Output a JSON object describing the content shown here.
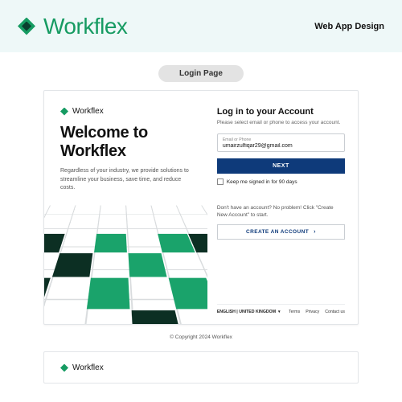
{
  "brand": {
    "name": "Workflex",
    "header_right": "Web App Design"
  },
  "section_label": "Login Page",
  "welcome": {
    "brand_small": "Workflex",
    "title_line1": "Welcome to",
    "title_line2": "Workflex",
    "subtitle": "Regardless of your industry, we provide solutions to streamline your business, save time, and reduce costs."
  },
  "login": {
    "heading": "Log in to your Account",
    "hint": "Please select email or phone to access your account.",
    "field_label": "Email or Phone",
    "field_value": "umairzulfiqar29@gmail.com",
    "next_label": "NEXT",
    "keep_label": "Keep me signed in for 90 days",
    "no_account_text": "Don't have an account? No problem! Click \"Create New Account\" to start.",
    "create_label": "CREATE AN ACCOUNT"
  },
  "footer": {
    "language": "ENGLISH | UNITED KINGDOM",
    "terms": "Terms",
    "privacy": "Privacy",
    "contact": "Contact us",
    "copyright": "© Copyright 2024 Workflex"
  },
  "peek": {
    "brand_small": "Workflex"
  },
  "colors": {
    "brand_green": "#169b62",
    "dark_green": "#0c2f23",
    "button_blue": "#0e3a7a",
    "hero_bg": "#eef8f8"
  }
}
